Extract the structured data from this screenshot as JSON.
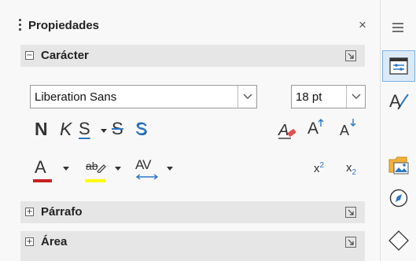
{
  "panel": {
    "title": "Propiedades",
    "close_glyph": "×",
    "menu_icon": "hamburger-menu-icon"
  },
  "sections": {
    "character": {
      "label": "Carácter",
      "toggle": "⊟",
      "expanded": true
    },
    "paragraph": {
      "label": "Párrafo",
      "toggle": "⊞",
      "expanded": false
    },
    "area": {
      "label": "Área",
      "toggle": "⊞",
      "expanded": false
    }
  },
  "character": {
    "font_name": "Liberation Sans",
    "font_size": "18 pt",
    "bold": "N",
    "italic": "K",
    "underline": "S",
    "strikethrough": "S",
    "shadow": "S",
    "grow": "A",
    "shrink": "A",
    "font_color": "A",
    "highlight": "ab",
    "spacing": "AV",
    "superscript": "x",
    "superscript_exp": "2",
    "subscript": "x",
    "subscript_exp": "2",
    "font_color_value": "#c9211e",
    "highlight_color_value": "#ffff00"
  },
  "sidebar": {
    "tabs": [
      {
        "name": "properties-icon",
        "active": true
      },
      {
        "name": "styles-icon",
        "active": false
      },
      {
        "name": "gallery-icon",
        "active": false
      },
      {
        "name": "navigator-icon",
        "active": false
      },
      {
        "name": "shapes-icon",
        "active": false
      }
    ]
  },
  "colors": {
    "accent": "#2a78c8",
    "section_header": "#e6e6e6",
    "active_tab": "#dceaf7"
  }
}
